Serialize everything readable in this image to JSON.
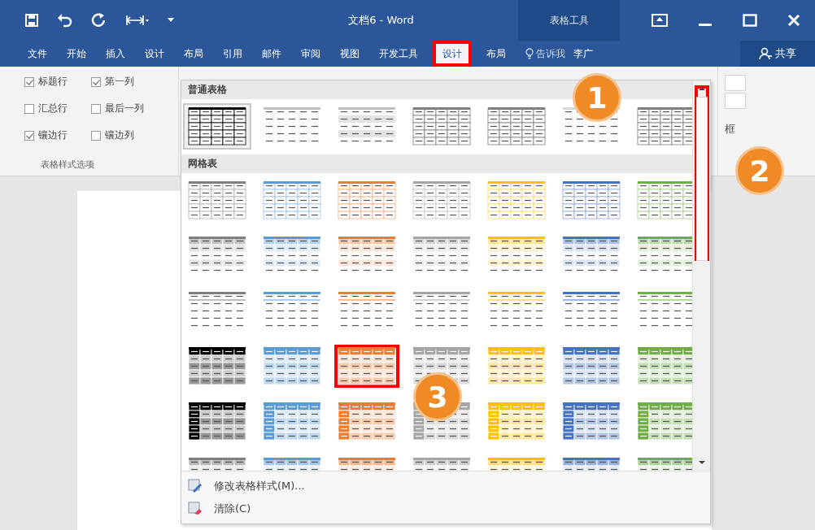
{
  "title_bar": {
    "title": "文档6 - Word",
    "context_label": "表格工具"
  },
  "tabs": [
    {
      "label": "文件",
      "selected": false,
      "highlighted": false
    },
    {
      "label": "开始",
      "selected": false,
      "highlighted": false
    },
    {
      "label": "插入",
      "selected": false,
      "highlighted": false
    },
    {
      "label": "设计",
      "selected": false,
      "highlighted": false
    },
    {
      "label": "布局",
      "selected": false,
      "highlighted": false
    },
    {
      "label": "引用",
      "selected": false,
      "highlighted": false
    },
    {
      "label": "邮件",
      "selected": false,
      "highlighted": false
    },
    {
      "label": "审阅",
      "selected": false,
      "highlighted": false
    },
    {
      "label": "视图",
      "selected": false,
      "highlighted": false
    },
    {
      "label": "开发工具",
      "selected": false,
      "highlighted": false
    },
    {
      "label": "设计",
      "selected": true,
      "highlighted": true
    },
    {
      "label": "布局",
      "selected": false,
      "highlighted": false
    }
  ],
  "tell_me": "告诉我",
  "user": "李广",
  "share_button": "共享",
  "style_options": {
    "items": [
      {
        "label": "标题行",
        "checked": true
      },
      {
        "label": "第一列",
        "checked": true
      },
      {
        "label": "汇总行",
        "checked": false
      },
      {
        "label": "最后一列",
        "checked": false
      },
      {
        "label": "镶边行",
        "checked": true
      },
      {
        "label": "镶边列",
        "checked": false
      }
    ],
    "group_label": "表格样式选项"
  },
  "ribbon_right": {
    "label": "框"
  },
  "gallery": {
    "sections": [
      {
        "title": "普通表格",
        "rows": [
          {
            "items": [
              {
                "kind": "grid",
                "color": "#000000",
                "selected": true,
                "highlighted": false
              },
              {
                "kind": "plain",
                "color": "#bfbfbf",
                "selected": false,
                "highlighted": false
              },
              {
                "kind": "banded-lines",
                "color": "#bfbfbf",
                "selected": false,
                "highlighted": false
              },
              {
                "kind": "lines",
                "color": "#7f7f7f",
                "selected": false,
                "highlighted": false
              },
              {
                "kind": "first-col-line",
                "color": "#7f7f7f",
                "selected": false,
                "highlighted": false
              },
              {
                "kind": "plain",
                "color": "#d9d9d9",
                "selected": false,
                "highlighted": false
              },
              {
                "kind": "col-lines",
                "color": "#7f7f7f",
                "selected": false,
                "highlighted": false
              }
            ]
          }
        ]
      },
      {
        "title": "网格表",
        "rows": [
          {
            "items": [
              {
                "kind": "light-grid",
                "color": "#7f7f7f",
                "selected": false,
                "highlighted": false
              },
              {
                "kind": "light-grid",
                "color": "#5b9bd5",
                "selected": false,
                "highlighted": false
              },
              {
                "kind": "light-grid",
                "color": "#ed7d31",
                "selected": false,
                "highlighted": false
              },
              {
                "kind": "light-grid",
                "color": "#a5a5a5",
                "selected": false,
                "highlighted": false
              },
              {
                "kind": "light-grid",
                "color": "#ffc000",
                "selected": false,
                "highlighted": false
              },
              {
                "kind": "light-grid",
                "color": "#4472c4",
                "selected": false,
                "highlighted": false
              },
              {
                "kind": "light-grid",
                "color": "#70ad47",
                "selected": false,
                "highlighted": false
              }
            ]
          },
          {
            "items": [
              {
                "kind": "banded",
                "color": "#7f7f7f",
                "selected": false,
                "highlighted": false
              },
              {
                "kind": "banded",
                "color": "#5b9bd5",
                "selected": false,
                "highlighted": false
              },
              {
                "kind": "banded",
                "color": "#ed7d31",
                "selected": false,
                "highlighted": false
              },
              {
                "kind": "banded",
                "color": "#a5a5a5",
                "selected": false,
                "highlighted": false
              },
              {
                "kind": "banded",
                "color": "#ffc000",
                "selected": false,
                "highlighted": false
              },
              {
                "kind": "banded",
                "color": "#4472c4",
                "selected": false,
                "highlighted": false
              },
              {
                "kind": "banded",
                "color": "#70ad47",
                "selected": false,
                "highlighted": false
              }
            ]
          },
          {
            "items": [
              {
                "kind": "list-light",
                "color": "#7f7f7f",
                "selected": false,
                "highlighted": false
              },
              {
                "kind": "list-light",
                "color": "#5b9bd5",
                "selected": false,
                "highlighted": false
              },
              {
                "kind": "list-light",
                "color": "#ed7d31",
                "selected": false,
                "highlighted": false
              },
              {
                "kind": "list-light",
                "color": "#a5a5a5",
                "selected": false,
                "highlighted": false
              },
              {
                "kind": "list-light",
                "color": "#ffc000",
                "selected": false,
                "highlighted": false
              },
              {
                "kind": "list-light",
                "color": "#4472c4",
                "selected": false,
                "highlighted": false
              },
              {
                "kind": "list-light",
                "color": "#70ad47",
                "selected": false,
                "highlighted": false
              }
            ]
          },
          {
            "items": [
              {
                "kind": "header",
                "color": "#000000",
                "selected": false,
                "highlighted": false
              },
              {
                "kind": "header",
                "color": "#5b9bd5",
                "selected": false,
                "highlighted": false
              },
              {
                "kind": "header",
                "color": "#ed7d31",
                "selected": false,
                "highlighted": true
              },
              {
                "kind": "header",
                "color": "#a5a5a5",
                "selected": false,
                "highlighted": false
              },
              {
                "kind": "header",
                "color": "#ffc000",
                "selected": false,
                "highlighted": false
              },
              {
                "kind": "header",
                "color": "#4472c4",
                "selected": false,
                "highlighted": false
              },
              {
                "kind": "header",
                "color": "#70ad47",
                "selected": false,
                "highlighted": false
              }
            ]
          },
          {
            "items": [
              {
                "kind": "first-col",
                "color": "#000000",
                "selected": false,
                "highlighted": false
              },
              {
                "kind": "first-col",
                "color": "#5b9bd5",
                "selected": false,
                "highlighted": false
              },
              {
                "kind": "first-col",
                "color": "#ed7d31",
                "selected": false,
                "highlighted": false
              },
              {
                "kind": "first-col",
                "color": "#a5a5a5",
                "selected": false,
                "highlighted": false
              },
              {
                "kind": "first-col",
                "color": "#ffc000",
                "selected": false,
                "highlighted": false
              },
              {
                "kind": "first-col",
                "color": "#4472c4",
                "selected": false,
                "highlighted": false
              },
              {
                "kind": "first-col",
                "color": "#70ad47",
                "selected": false,
                "highlighted": false
              }
            ]
          },
          {
            "items": [
              {
                "kind": "list",
                "color": "#7f7f7f",
                "selected": false,
                "highlighted": false
              },
              {
                "kind": "list",
                "color": "#5b9bd5",
                "selected": false,
                "highlighted": false
              },
              {
                "kind": "list",
                "color": "#ed7d31",
                "selected": false,
                "highlighted": false
              },
              {
                "kind": "list",
                "color": "#a5a5a5",
                "selected": false,
                "highlighted": false
              },
              {
                "kind": "list",
                "color": "#ffc000",
                "selected": false,
                "highlighted": false
              },
              {
                "kind": "list",
                "color": "#4472c4",
                "selected": false,
                "highlighted": false
              },
              {
                "kind": "list",
                "color": "#70ad47",
                "selected": false,
                "highlighted": false
              }
            ]
          }
        ]
      }
    ],
    "scrollbar": {
      "highlighted": true
    },
    "menu": [
      {
        "label": "修改表格样式(M)...",
        "kind": "edit"
      },
      {
        "label": "清除(C)",
        "kind": "clear"
      }
    ]
  },
  "callouts": [
    {
      "number": "1"
    },
    {
      "number": "2"
    },
    {
      "number": "3"
    }
  ]
}
